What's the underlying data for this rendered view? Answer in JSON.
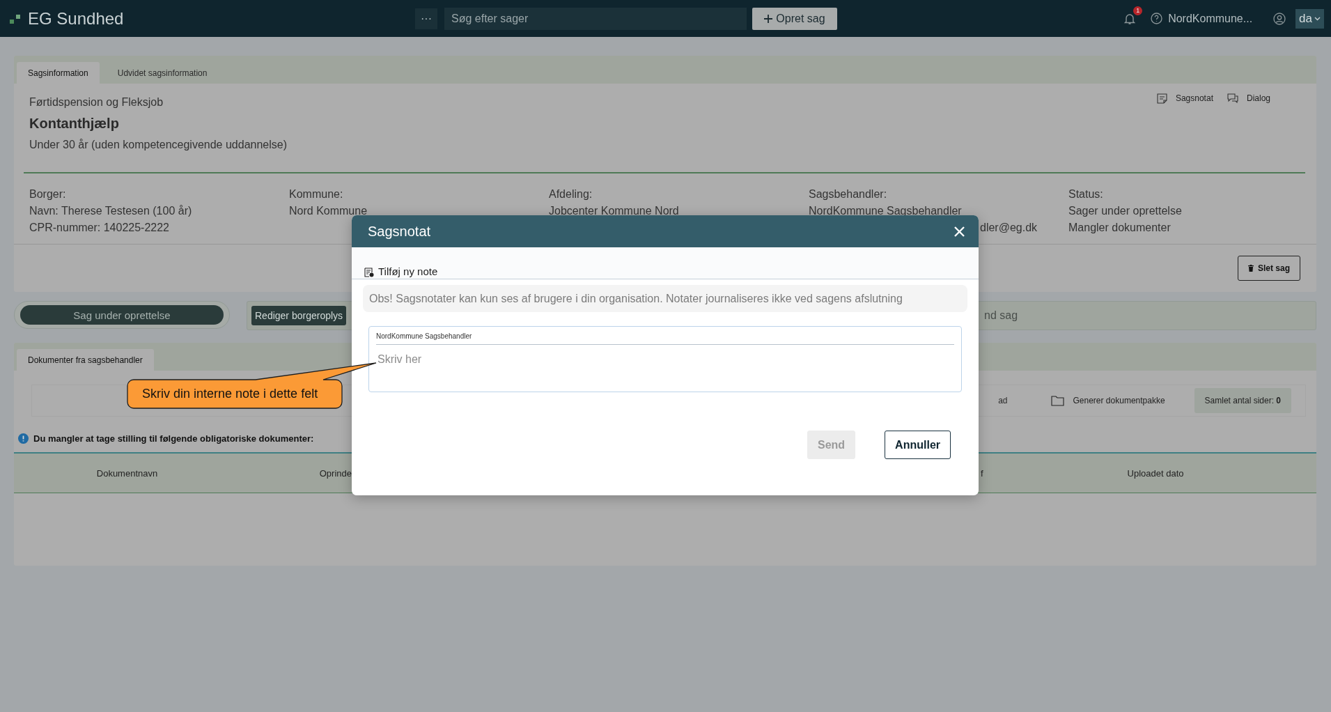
{
  "topbar": {
    "logo": "EG Sundhed",
    "more_button": "···",
    "search": {
      "placeholder": "Søg efter sager"
    },
    "create_button": "Opret sag",
    "notification_count": "1",
    "user": "NordKommune...",
    "language": "da"
  },
  "case_panel": {
    "tabs": [
      {
        "label": "Sagsinformation",
        "selected": true
      },
      {
        "label": "Udvidet sagsinformation",
        "selected": false
      }
    ],
    "category": "Førtidspension og Fleksjob",
    "title": "Kontanthjælp",
    "subtitle": "Under 30 år (uden kompetencegivende uddannelse)",
    "actions": [
      {
        "kind": "note",
        "label": "Sagsnotat"
      },
      {
        "kind": "dialog",
        "label": "Dialog"
      }
    ],
    "info_columns": [
      {
        "heading": "Borger:",
        "lines": [
          "Navn: Therese Testesen (100 år)",
          "CPR-nummer: 140225-2222"
        ]
      },
      {
        "heading": "Kommune:",
        "lines": [
          "Nord Kommune"
        ]
      },
      {
        "heading": "Afdeling:",
        "lines": [
          "Jobcenter Kommune Nord"
        ]
      },
      {
        "heading": "Sagsbehandler:",
        "lines": [
          "NordKommune Sagsbehandler",
          "dler@eg.dk"
        ]
      },
      {
        "heading": "Status:",
        "lines": [
          "Sager under oprettelse",
          "Mangler dokumenter"
        ]
      }
    ],
    "delete_button": "Slet sag"
  },
  "status_row": {
    "status_button": "Sag under oprettelse",
    "edit_button": "Rediger borgeroplys",
    "fragment": "nd sag"
  },
  "documents_panel": {
    "tabs": [
      {
        "label": "Dokumenter fra sagsbehandler",
        "selected": true
      }
    ],
    "toolbar_fragment": "ad",
    "generate_button": "Generer dokumentpakke",
    "page_total": "Samlet antal sider: **0**",
    "notice": "Du mangler at tage stilling til følgende obligatoriske dokumenter:",
    "columns": [
      "Dokumentnavn",
      "Oprinde",
      "f",
      "Uploadet dato"
    ]
  },
  "modal": {
    "title": "Sagsnotat",
    "section_label": "Tilføj ny note",
    "notice": "Obs! Sagsnotater kan kun ses af brugere i din organisation. Notater journaliseres ikke ved sagens afslutning",
    "note_field": {
      "author": "NordKommune Sagsbehandler",
      "placeholder": "Skriv her"
    },
    "buttons": [
      {
        "label": "Send",
        "disabled": true
      },
      {
        "label": "Annuller",
        "disabled": false
      }
    ]
  },
  "callout": {
    "text": "Skriv din interne note i dette felt"
  }
}
